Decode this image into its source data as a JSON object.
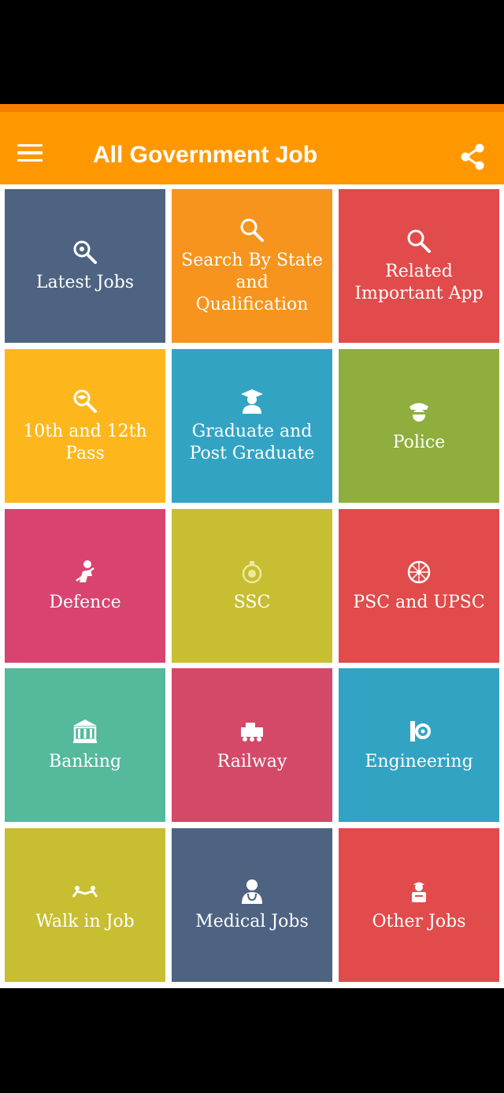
{
  "app": {
    "title": "All Government Job",
    "accent_color": "#FF9800"
  },
  "header": {
    "menu_icon": "hamburger-menu-icon",
    "share_icon": "share-icon"
  },
  "tiles": [
    {
      "label": "Latest Jobs",
      "color": "#4E6382",
      "icon": "search-plus-icon"
    },
    {
      "label": "Search By State and Qualification",
      "color": "#F7941D",
      "icon": "search-icon"
    },
    {
      "label": "Related Important App",
      "color": "#E14B4B",
      "icon": "search-icon"
    },
    {
      "label": "10th and 12th Pass",
      "color": "#FDB71D",
      "icon": "search-graduation-icon"
    },
    {
      "label": "Graduate and Post Graduate",
      "color": "#33A3C4",
      "icon": "graduate-icon"
    },
    {
      "label": "Police",
      "color": "#8FAE3D",
      "icon": "police-officer-icon"
    },
    {
      "label": "Defence",
      "color": "#D94370",
      "icon": "soldier-icon"
    },
    {
      "label": "SSC",
      "color": "#C7BE31",
      "icon": "emblem-icon"
    },
    {
      "label": "PSC and UPSC",
      "color": "#E14B4B",
      "icon": "ashoka-chakra-icon"
    },
    {
      "label": "Banking",
      "color": "#55B99B",
      "icon": "bank-icon"
    },
    {
      "label": "Railway",
      "color": "#D44868",
      "icon": "train-icon"
    },
    {
      "label": "Engineering",
      "color": "#33A3C4",
      "icon": "engineering-tools-icon"
    },
    {
      "label": "Walk in Job",
      "color": "#C7BE31",
      "icon": "handshake-icon"
    },
    {
      "label": "Medical Jobs",
      "color": "#4E6382",
      "icon": "doctor-icon"
    },
    {
      "label": "Other Jobs",
      "color": "#E14B4B",
      "icon": "worker-icon"
    }
  ]
}
